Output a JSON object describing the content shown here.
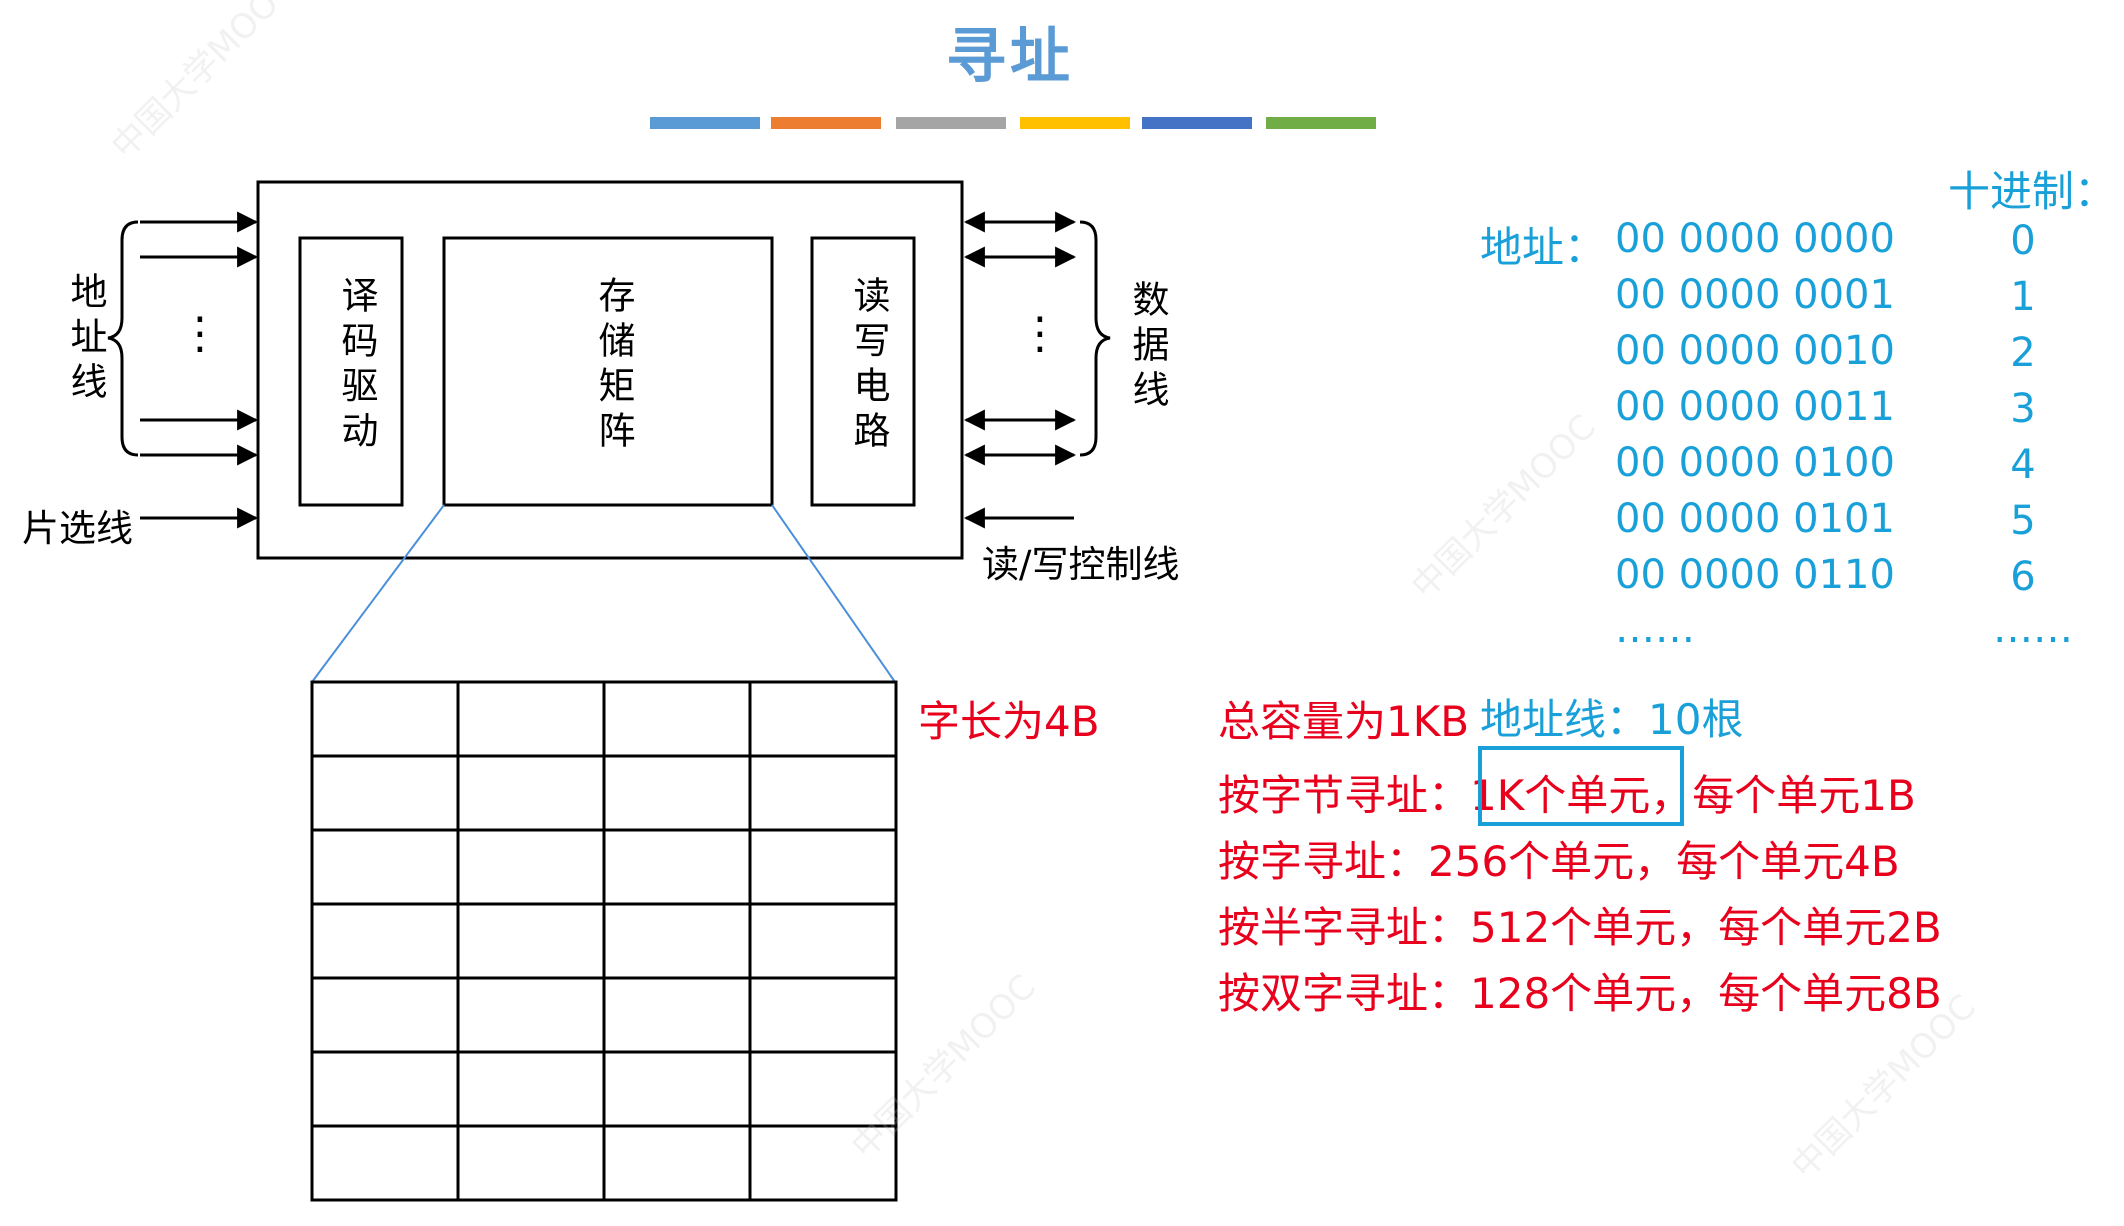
{
  "title": "寻址",
  "color_bars": [
    "#5b9bd5",
    "#ed7d31",
    "#a5a5a5",
    "#ffc000",
    "#4472c4",
    "#70ad47"
  ],
  "diagram": {
    "address_lines_label": "地址线",
    "decoder_label": "译码驱动",
    "matrix_label": "存储矩阵",
    "rw_circuit_label": "读写电路",
    "data_lines_label": "数据线",
    "chip_select_label": "片选线",
    "rw_control_label": "读/写控制线",
    "ellipsis": "⋮"
  },
  "word_length_note": "字长为4B",
  "decimal_header": "十进制：",
  "address_label": "地址：",
  "address_rows": [
    {
      "binary": "00 0000 0000",
      "decimal": "0"
    },
    {
      "binary": "00 0000 0001",
      "decimal": "1"
    },
    {
      "binary": "00 0000 0010",
      "decimal": "2"
    },
    {
      "binary": "00 0000 0011",
      "decimal": "3"
    },
    {
      "binary": "00 0000 0100",
      "decimal": "4"
    },
    {
      "binary": "00 0000 0101",
      "decimal": "5"
    },
    {
      "binary": "00 0000 0110",
      "decimal": "6"
    }
  ],
  "address_more": "……",
  "decimal_more": "……",
  "capacity_text": "总容量为1KB",
  "address_lines_count": "地址线：10根",
  "byte_addr": {
    "prefix": "按字节寻址：",
    "units": "1K个单元",
    "suffix": "，每个单元1B"
  },
  "word_addr": "按字寻址：256个单元，每个单元4B",
  "halfword_addr": "按半字寻址：512个单元，每个单元2B",
  "doubleword_addr": "按双字寻址：128个单元，每个单元8B",
  "grid": {
    "rows": 7,
    "cols": 4
  }
}
